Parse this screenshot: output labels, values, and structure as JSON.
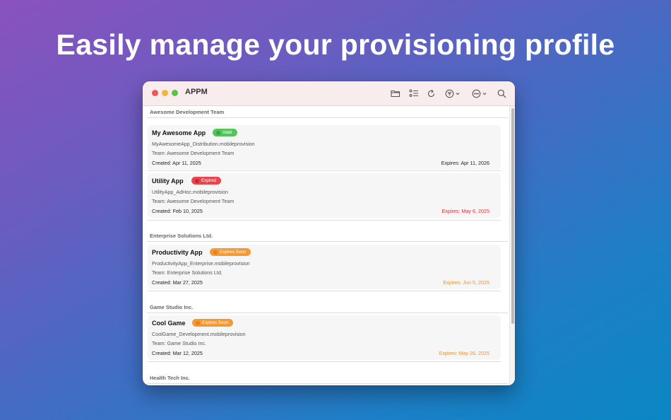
{
  "headline": "Easily manage your provisioning profile",
  "window": {
    "title": "APPM"
  },
  "toolbar": {
    "icons": [
      "folder-icon",
      "checklist-icon",
      "refresh-icon",
      "filter-icon",
      "more-icon",
      "search-icon"
    ]
  },
  "colors": {
    "valid": "#54c45a",
    "expired": "#e8454d",
    "expires_soon": "#f29a35",
    "expired_text": "#e5323c",
    "expires_soon_text": "#f0912a"
  },
  "sections": [
    {
      "name": "Awesome Development Team",
      "profiles": [
        {
          "name": "My Awesome App",
          "status": "Valid",
          "file": "MyAwesomeApp_Distribution.mobileprovision",
          "team": "Team: Awesome Development Team",
          "created": "Created: Apr 11, 2025",
          "expires": "Expires: Apr 11, 2026"
        },
        {
          "name": "Utility App",
          "status": "Expired",
          "file": "UtilityApp_AdHoc.mobileprovision",
          "team": "Team: Awesome Development Team",
          "created": "Created: Feb 10, 2025",
          "expires": "Expires: May 6, 2025"
        }
      ]
    },
    {
      "name": "Enterprise Solutions Ltd.",
      "profiles": [
        {
          "name": "Productivity App",
          "status": "Expires Soon",
          "file": "ProductivityApp_Enterprise.mobileprovision",
          "team": "Team: Enterprise Solutions Ltd.",
          "created": "Created: Mar 27, 2025",
          "expires": "Expires: Jun 5, 2025"
        }
      ]
    },
    {
      "name": "Game Studio Inc.",
      "profiles": [
        {
          "name": "Cool Game",
          "status": "Expires Soon",
          "file": "CoolGame_Development.mobileprovision",
          "team": "Team: Game Studio Inc.",
          "created": "Created: Mar 12, 2025",
          "expires": "Expires: May 26, 2025"
        }
      ]
    },
    {
      "name": "Health Tech Inc.",
      "profiles": []
    }
  ]
}
